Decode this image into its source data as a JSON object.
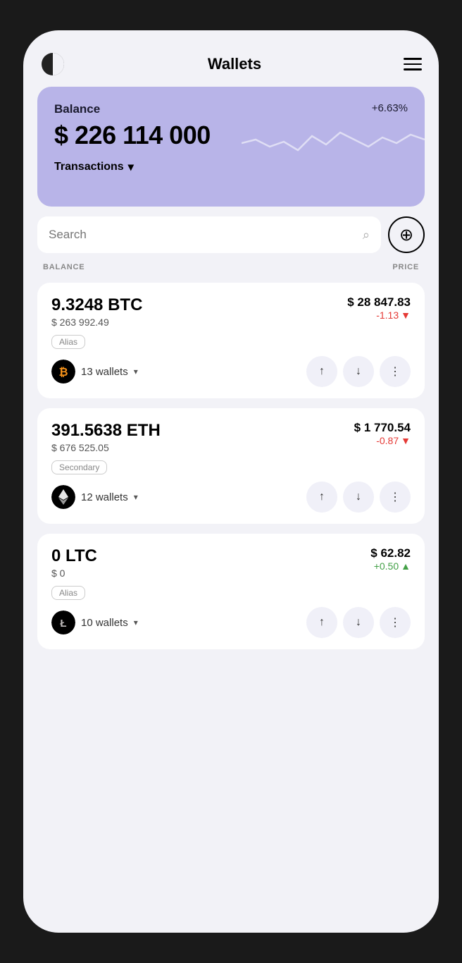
{
  "app": {
    "title": "Wallets"
  },
  "header": {
    "logo": "half-circle-icon",
    "menu": "menu-icon"
  },
  "balance_card": {
    "label": "Balance",
    "percent": "+6.63%",
    "amount": "$ 226 114 000",
    "transactions_label": "Transactions"
  },
  "search": {
    "placeholder": "Search",
    "add_label": "+"
  },
  "table_headers": {
    "balance": "BALANCE",
    "price": "PRICE"
  },
  "coins": [
    {
      "amount": "9.3248 BTC",
      "usd_value": "$ 263 992.49",
      "alias": "Alias",
      "wallets_count": "13 wallets",
      "price": "$ 28 847.83",
      "change": "-1.13",
      "change_type": "negative",
      "logo_type": "btc"
    },
    {
      "amount": "391.5638 ETH",
      "usd_value": "$ 676 525.05",
      "alias": "Secondary",
      "wallets_count": "12 wallets",
      "price": "$ 1 770.54",
      "change": "-0.87",
      "change_type": "negative",
      "logo_type": "eth"
    },
    {
      "amount": "0 LTC",
      "usd_value": "$ 0",
      "alias": "Alias",
      "wallets_count": "10 wallets",
      "price": "$ 62.82",
      "change": "+0.50",
      "change_type": "positive",
      "logo_type": "ltc"
    }
  ]
}
